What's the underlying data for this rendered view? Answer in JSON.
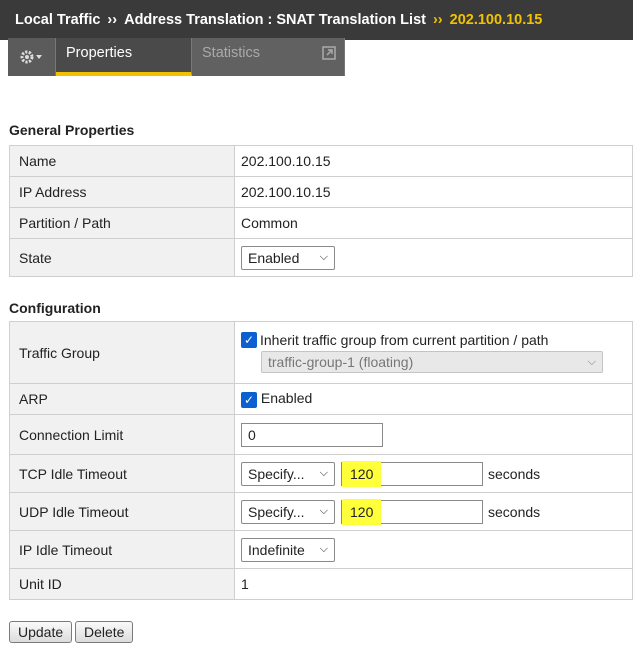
{
  "breadcrumb": {
    "part1": "Local Traffic",
    "sep": "››",
    "part2": "Address Translation : SNAT Translation List",
    "current": "202.100.10.15"
  },
  "tabs": {
    "gear_icon": "gear-icon",
    "properties": "Properties",
    "statistics": "Statistics"
  },
  "general": {
    "title": "General Properties",
    "name_label": "Name",
    "name_value": "202.100.10.15",
    "ip_label": "IP Address",
    "ip_value": "202.100.10.15",
    "partition_label": "Partition / Path",
    "partition_value": "Common",
    "state_label": "State",
    "state_value": "Enabled"
  },
  "config": {
    "title": "Configuration",
    "traffic_group_label": "Traffic Group",
    "inherit_label": "Inherit traffic group from current partition / path",
    "traffic_group_value": "traffic-group-1 (floating)",
    "arp_label": "ARP",
    "arp_value": "Enabled",
    "conn_limit_label": "Connection Limit",
    "conn_limit_value": "0",
    "tcp_label": "TCP Idle Timeout",
    "tcp_mode": "Specify...",
    "tcp_value": "120",
    "udp_label": "UDP Idle Timeout",
    "udp_mode": "Specify...",
    "udp_value": "120",
    "seconds": "seconds",
    "ip_idle_label": "IP Idle Timeout",
    "ip_idle_value": "Indefinite",
    "unit_label": "Unit ID",
    "unit_value": "1"
  },
  "buttons": {
    "update": "Update",
    "delete": "Delete"
  }
}
